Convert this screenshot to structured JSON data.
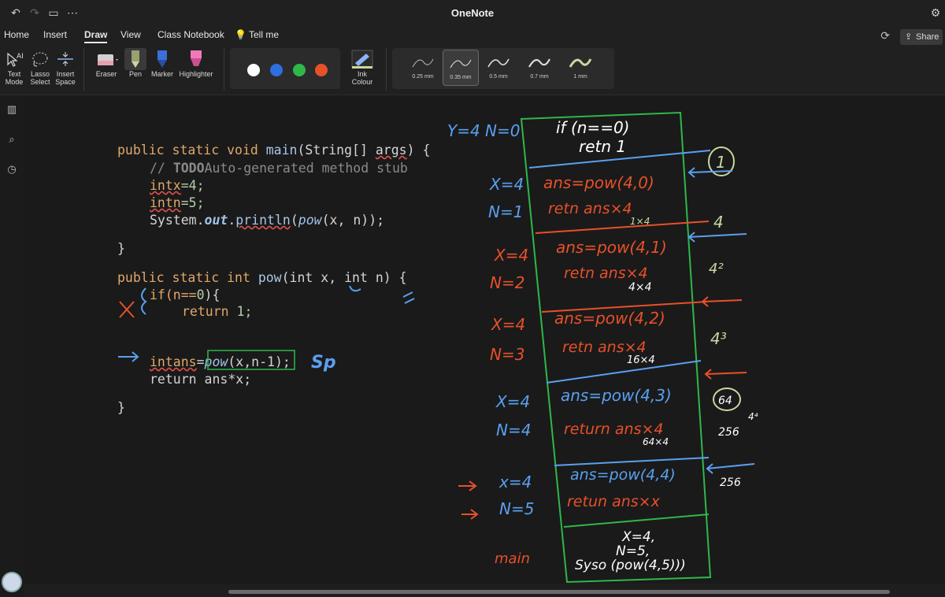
{
  "app": {
    "title": "OneNote"
  },
  "menu": {
    "tabs": [
      {
        "label": "Home"
      },
      {
        "label": "Insert"
      },
      {
        "label": "Draw"
      },
      {
        "label": "View"
      },
      {
        "label": "Class Notebook"
      }
    ],
    "tell_me": "Tell me",
    "share": "Share"
  },
  "ribbon": {
    "tools": [
      {
        "label": "Text\nMode",
        "icon": "text-mode-icon"
      },
      {
        "label": "Lasso\nSelect",
        "icon": "lasso-icon"
      },
      {
        "label": "Insert\nSpace",
        "icon": "insert-space-icon"
      }
    ],
    "pens": [
      {
        "label": "Eraser",
        "icon": "eraser-icon",
        "color": "#e8a0b0"
      },
      {
        "label": "Pen",
        "icon": "pen-icon",
        "color": "#c8d8a0"
      },
      {
        "label": "Marker",
        "icon": "marker-icon",
        "color": "#3a6fd8"
      },
      {
        "label": "Highlighter",
        "icon": "highlighter-icon",
        "color": "#f07ab8"
      }
    ],
    "colors": [
      "#ffffff",
      "#2f6fe0",
      "#2eb84a",
      "#e8502a"
    ],
    "ink_colour": "Ink\nColour",
    "thickness": [
      "0.25 mm",
      "0.35 mm",
      "0.5 mm",
      "0.7 mm",
      "1 mm"
    ],
    "selected_thickness": "0.35 mm"
  },
  "code": {
    "line1_kw": "public static void ",
    "line1_fn": "main",
    "line1_rest": "(String[] ",
    "line1_args": "args",
    "line1_end": ") {",
    "line2_cm": "// ",
    "line2_todo": "TODO",
    "line2_rest": "Auto-generated method stub",
    "line3": "intx",
    "line3_val": "=4;",
    "line4": "intn",
    "line4_val": "=5;",
    "line5_a": "System.",
    "line5_out": "out",
    "line5_b": ".",
    "line5_println": "println",
    "line5_c": "(",
    "line5_pow": "pow",
    "line5_d": "(x, n));",
    "close1": "}",
    "pow_sig_kw": "public static int ",
    "pow_sig_fn": "pow",
    "pow_sig_rest": "(int x, int n) {",
    "if_line": "if(n==",
    "if_zero": "0",
    "if_end": "){",
    "ret1_kw": "return ",
    "ret1_val": "1;",
    "close_if": "}",
    "ans_decl": "intans",
    "ans_eq": "=",
    "ans_pow": "pow",
    "ans_args": "(x,n-1);",
    "ret2": "return ans*x;",
    "close2": "}"
  },
  "ink": {
    "sp": "Sp",
    "top_xn": "Y=4 N=0",
    "frames": [
      {
        "x": "X=4",
        "n": "N=1",
        "call": "ans=pow(4,0)",
        "ret": "retn ans×4",
        "sub": "1×4",
        "side": "4"
      },
      {
        "x": "X=4",
        "n": "N=2",
        "call": "ans=pow(4,1)",
        "ret": "retn ans×4",
        "sub": "4×4",
        "side": "4²"
      },
      {
        "x": "X=4",
        "n": "N=3",
        "call": "ans=pow(4,2)",
        "ret": "retn ans×4",
        "sub": "16×4",
        "side": "4³"
      },
      {
        "x": "X=4",
        "n": "N=4",
        "call": "ans=pow(4,3)",
        "ret": "return ans×4",
        "sub": "64×4",
        "side": "256"
      },
      {
        "x": "x=4",
        "n": "N=5",
        "call": "ans=pow(4,4)",
        "ret": "retun ans×x",
        "sub": "",
        "side": "256"
      }
    ],
    "base_if": "if (n==0)",
    "base_ret": "retn 1",
    "circle_one": "1",
    "circle_64": "64",
    "exp_44": "4⁴",
    "main_label": "main",
    "main_x": "X=4,",
    "main_n": "N=5,",
    "main_call": "Syso (pow(4,5)))"
  }
}
